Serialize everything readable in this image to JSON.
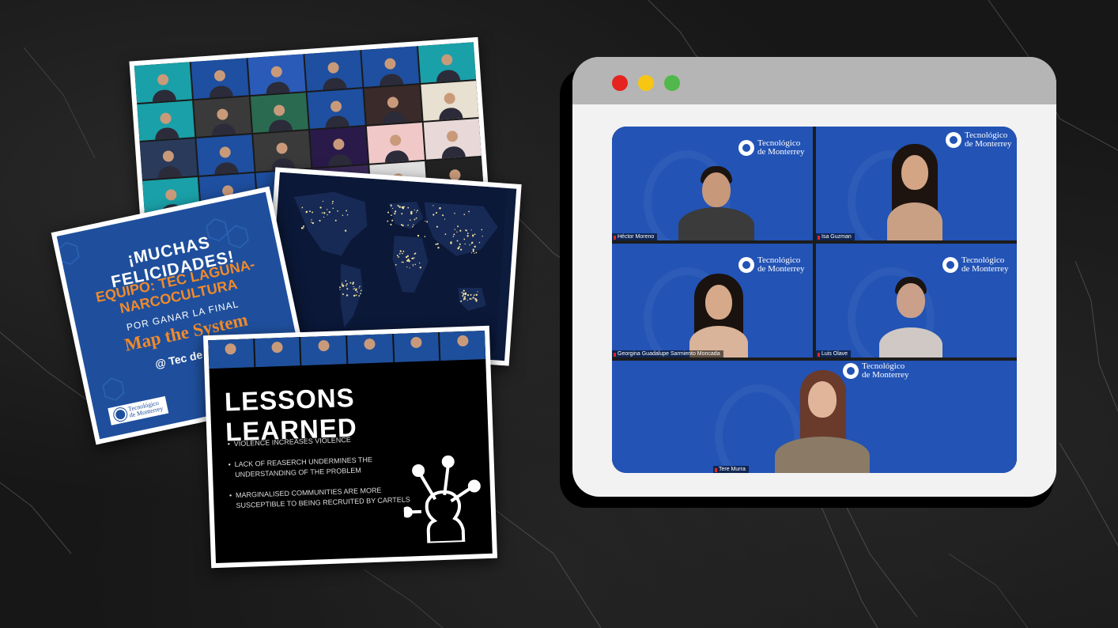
{
  "browser": {
    "window_dots": [
      "#e52420",
      "#f7c613",
      "#51b84b"
    ],
    "participants": [
      {
        "name": "Héctor Moreno",
        "logo": [
          "Tecnológico",
          "de Monterrey"
        ]
      },
      {
        "name": "Isa Guzman",
        "logo": [
          "Tecnológico",
          "de Monterrey"
        ]
      },
      {
        "name": "Georgina Guadalupe Sarmiento Moncada",
        "logo": [
          "Tecnológico",
          "de Monterrey"
        ]
      },
      {
        "name": "Luis Olave",
        "logo": [
          "Tecnológico",
          "de Monterrey"
        ]
      },
      {
        "name": "Tere Murra",
        "logo": [
          "Tecnológico",
          "de Monterrey"
        ]
      }
    ]
  },
  "congrats_card": {
    "title": "¡MUCHAS FELICIDADES!",
    "team_line1": "EQUIPO: TEC LAGUNA-",
    "team_line2": "NARCOCULTURA",
    "subtitle": "POR GANAR LA FINAL",
    "event": "Map the System",
    "at": "@ Tec de Mon",
    "logo": [
      "Tecnológico",
      "de Monterrey"
    ]
  },
  "lessons_card": {
    "title": "LESSONS LEARNED",
    "bullets": [
      "VIOLENCE INCREASES VIOLENCE",
      "LACK OF REASERCH UNDERMINES THE UNDERSTANDING OF THE PROBLEM",
      "MARGINALISED COMMUNITIES ARE MORE SUSCEPTIBLE TO BEING RECRUITED BY CARTELS"
    ]
  }
}
